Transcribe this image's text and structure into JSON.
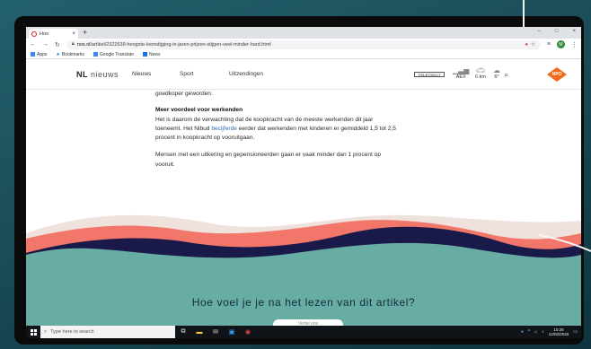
{
  "browser": {
    "tab_title": "Hoo",
    "tab_close": "×",
    "new_tab": "+",
    "url_domain": "nos.nl",
    "url_path": "/artikel/2322639-hoogste-loonstijging-in-jaren-prijzen-stijgen-veel-minder-hard.html",
    "profile_initial": "M",
    "window_controls": [
      "–",
      "□",
      "×"
    ]
  },
  "bookmarks": [
    {
      "label": "Apps",
      "icon": "apps-grid-icon",
      "color": "#4285f4"
    },
    {
      "label": "Bookmarks",
      "icon": "star-icon",
      "color": "#1a73e8"
    },
    {
      "label": "Google Translate",
      "icon": "translate-icon",
      "color": "#4285f4"
    },
    {
      "label": "News",
      "icon": "news-icon",
      "color": "#1a73e8"
    }
  ],
  "site": {
    "logo_brand": "NL",
    "logo_word": "nieuws",
    "nav": [
      "Nieuws",
      "Sport",
      "Uitzendingen"
    ],
    "teletekst": "TELETEKST",
    "weather": [
      {
        "label": "AEX",
        "icon": "chart-icon"
      },
      {
        "label": "6 km",
        "icon": "car-icon"
      },
      {
        "label": "6°",
        "icon": "cloud-rain-icon"
      }
    ],
    "npo_logo": "NPO"
  },
  "article": {
    "intro_tail": "goedkoper geworden.",
    "heading": "Meer voordeel voor werkenden",
    "p1_a": "Het is daarom de verwachting dat de koopkracht van de meeste werkenden dit jaar toeneemt. Het Nibud ",
    "p1_link": "becijferde",
    "p1_b": " eerder dat werkenden met kinderen er gemiddeld 1,5 tot 2,5 procent in koopkracht op vooruitgaan.",
    "p2": "Mensen met een uitkering en gepensioneerden gaan er vaak minder dan 1 procent op vooruit."
  },
  "feedback": {
    "question": "Hoe voel je je na het lezen van dit artikel?",
    "button": "Vertel ons"
  },
  "taskbar": {
    "search_placeholder": "Type here to search",
    "time": "10:25",
    "date": "12/02/2020"
  },
  "colors": {
    "wave_teal": "#68ada4",
    "wave_navy": "#1a1a4a",
    "wave_coral": "#f2766a",
    "wave_beige": "#efe1dc",
    "npo_orange": "#f26a1b",
    "link_blue": "#2b6fb3"
  }
}
